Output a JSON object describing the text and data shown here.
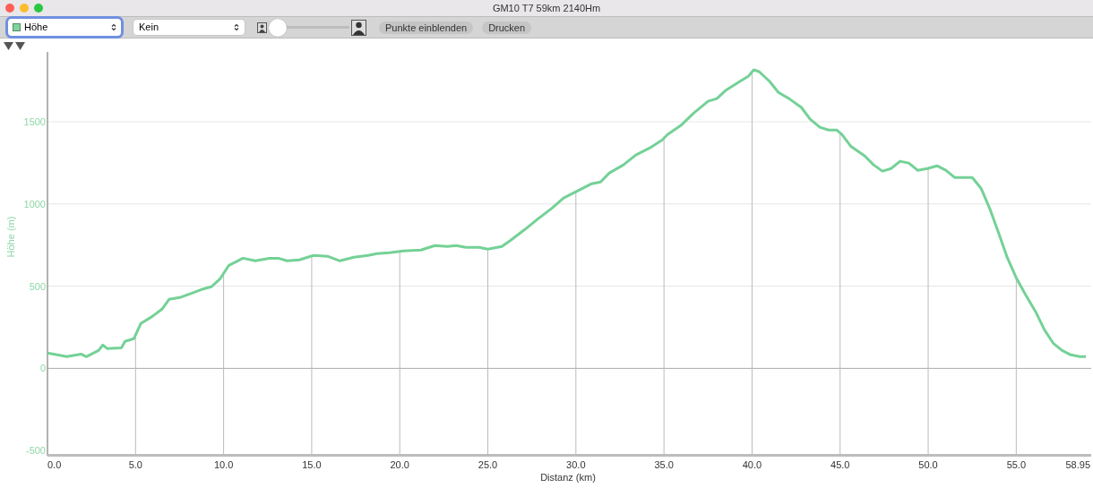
{
  "window": {
    "title": "GM10 T7 59km 2140Hm"
  },
  "toolbar": {
    "primary_select": {
      "value": "Höhe",
      "color": "#7fd49b",
      "focused": true
    },
    "secondary_select": {
      "value": "Kein",
      "focused": false
    },
    "slider": {
      "level": 0
    },
    "buttons": [
      "Punkte einblenden",
      "Drucken"
    ]
  },
  "chart": {
    "chart_data": {
      "type": "line",
      "xlabel": "Distanz (km)",
      "ylabel": "Höhe (m)",
      "grid": true,
      "ref_lines": [
        {
          "axis": "x",
          "value": 5
        },
        {
          "axis": "x",
          "value": 10
        },
        {
          "axis": "x",
          "value": 15
        },
        {
          "axis": "x",
          "value": 20
        },
        {
          "axis": "x",
          "value": 25
        },
        {
          "axis": "x",
          "value": 30
        },
        {
          "axis": "x",
          "value": 35
        },
        {
          "axis": "x",
          "value": 40
        },
        {
          "axis": "x",
          "value": 45
        },
        {
          "axis": "x",
          "value": 50
        },
        {
          "axis": "x",
          "value": 55
        }
      ],
      "xlim": [
        0,
        58.95
      ],
      "ylim": [
        -510,
        1925
      ],
      "xticks": [
        {
          "value": 0,
          "label": "0.0"
        },
        {
          "value": 5,
          "label": "5.0"
        },
        {
          "value": 10,
          "label": "10.0"
        },
        {
          "value": 15,
          "label": "15.0"
        },
        {
          "value": 20,
          "label": "20.0"
        },
        {
          "value": 25,
          "label": "25.0"
        },
        {
          "value": 30,
          "label": "30.0"
        },
        {
          "value": 35,
          "label": "35.0"
        },
        {
          "value": 40,
          "label": "40.0"
        },
        {
          "value": 45,
          "label": "45.0"
        },
        {
          "value": 50,
          "label": "50.0"
        },
        {
          "value": 55,
          "label": "55.0"
        },
        {
          "value": 58.95,
          "label": "58.95"
        }
      ],
      "yticks": [
        -500,
        0,
        500,
        1000,
        1500
      ],
      "x": [
        0,
        1.1,
        1.9,
        2.2,
        2.9,
        3.15,
        3.4,
        4.2,
        4.4,
        4.9,
        5.3,
        5.95,
        6.5,
        6.9,
        7.5,
        8.2,
        8.75,
        9.3,
        9.8,
        10.3,
        10.8,
        11.1,
        11.8,
        12.6,
        13.1,
        13.6,
        14.3,
        15.1,
        15.9,
        16.6,
        17.4,
        18.2,
        18.7,
        19.4,
        20.2,
        21.2,
        22.0,
        22.7,
        23.2,
        23.75,
        24.5,
        25.0,
        25.8,
        26.3,
        27.1,
        27.8,
        28.6,
        29.3,
        30.1,
        30.9,
        31.4,
        31.9,
        32.7,
        33.4,
        34.2,
        34.9,
        35.2,
        35.96,
        36.7,
        37.5,
        38.0,
        38.5,
        39.3,
        39.8,
        40.1,
        40.4,
        41.0,
        41.5,
        42.1,
        42.8,
        43.3,
        43.85,
        44.35,
        44.8,
        45.1,
        45.6,
        46.4,
        46.9,
        47.4,
        47.9,
        48.4,
        48.9,
        49.4,
        49.95,
        50.5,
        51.0,
        51.5,
        52.0,
        52.5,
        53.0,
        53.5,
        54.0,
        54.5,
        55.0,
        55.5,
        56.1,
        56.6,
        57.1,
        57.6,
        58.1,
        58.6,
        58.95
      ],
      "series": [
        {
          "color": "#74d196",
          "values": [
            93,
            71,
            87,
            71,
            109,
            142,
            120,
            125,
            164,
            180,
            273,
            316,
            360,
            420,
            431,
            458,
            480,
            496,
            545,
            627,
            654,
            670,
            654,
            670,
            670,
            654,
            660,
            687,
            682,
            654,
            676,
            687,
            698,
            703,
            714,
            720,
            747,
            742,
            747,
            736,
            736,
            725,
            742,
            780,
            845,
            905,
            971,
            1036,
            1080,
            1123,
            1134,
            1189,
            1238,
            1298,
            1341,
            1390,
            1423,
            1478,
            1554,
            1625,
            1641,
            1690,
            1745,
            1778,
            1816,
            1805,
            1745,
            1679,
            1641,
            1587,
            1516,
            1467,
            1450,
            1450,
            1423,
            1352,
            1292,
            1238,
            1200,
            1216,
            1260,
            1249,
            1205,
            1216,
            1232,
            1205,
            1161,
            1161,
            1161,
            1096,
            971,
            823,
            671,
            551,
            453,
            344,
            234,
            153,
            109,
            82,
            71,
            71
          ]
        }
      ]
    }
  }
}
